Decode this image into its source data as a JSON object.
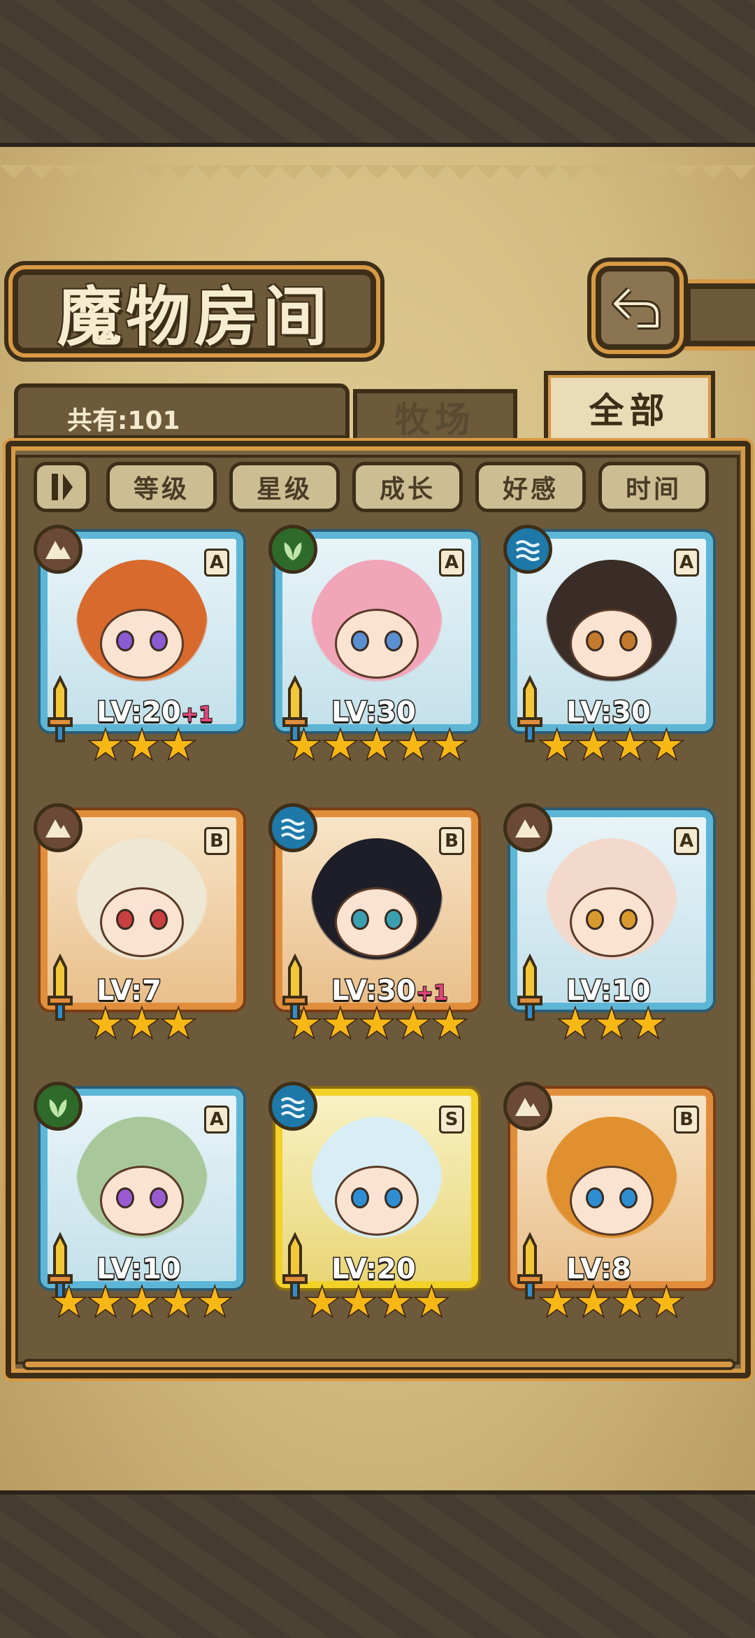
{
  "header": {
    "title": "魔物房间",
    "back_icon": "back-arrow-icon"
  },
  "summary": {
    "count_text": "共有:101"
  },
  "tabs": [
    {
      "label": "牧场",
      "active": false
    },
    {
      "label": "全部",
      "active": true
    }
  ],
  "sort": {
    "toggle_icon": "sort-order-icon",
    "options": [
      "等级",
      "星级",
      "成长",
      "好感",
      "时间"
    ]
  },
  "monsters": [
    {
      "element": "earth",
      "rarity": "A",
      "level": "LV:20",
      "bonus": "+1",
      "stars": 3,
      "hair": "#d86a2e",
      "eye": "#8a5bd1"
    },
    {
      "element": "grass",
      "rarity": "A",
      "level": "LV:30",
      "bonus": "",
      "stars": 5,
      "hair": "#f0a6b8",
      "eye": "#5a8fd1"
    },
    {
      "element": "water",
      "rarity": "A",
      "level": "LV:30",
      "bonus": "",
      "stars": 4,
      "hair": "#3a2c26",
      "eye": "#c27a2e"
    },
    {
      "element": "earth",
      "rarity": "B",
      "level": "LV:7",
      "bonus": "",
      "stars": 3,
      "hair": "#eee7d4",
      "eye": "#c84040"
    },
    {
      "element": "water",
      "rarity": "B",
      "level": "LV:30",
      "bonus": "+1",
      "stars": 5,
      "hair": "#1e1e28",
      "eye": "#3aa0b0"
    },
    {
      "element": "earth",
      "rarity": "A",
      "level": "LV:10",
      "bonus": "",
      "stars": 3,
      "hair": "#f3d8cc",
      "eye": "#d89a2e"
    },
    {
      "element": "grass",
      "rarity": "A",
      "level": "LV:10",
      "bonus": "",
      "stars": 5,
      "hair": "#a8c79a",
      "eye": "#9a5bd1"
    },
    {
      "element": "water",
      "rarity": "S",
      "level": "LV:20",
      "bonus": "",
      "stars": 4,
      "hair": "#d8eef4",
      "eye": "#2e8ed1"
    },
    {
      "element": "earth",
      "rarity": "B",
      "level": "LV:8",
      "bonus": "",
      "stars": 4,
      "hair": "#e0902e",
      "eye": "#2e8ed1"
    }
  ]
}
